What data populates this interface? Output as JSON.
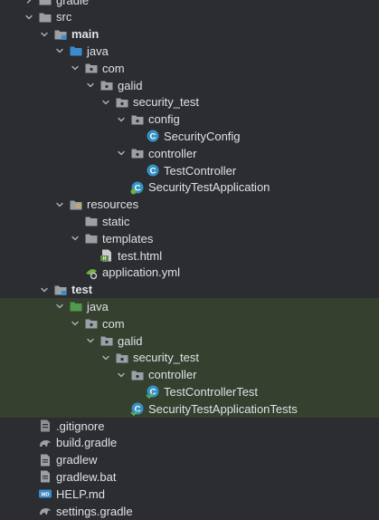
{
  "colors": {
    "background": "#2b2d30",
    "highlight": "#36402f",
    "text": "#dfe1e5",
    "folder": "#9aa0a6",
    "source_folder": "#3c8bcb",
    "test_folder": "#4e9a4e",
    "class_icon": "#3592c4",
    "app_icon": "#3592c4"
  },
  "tree": [
    {
      "label": "gradle",
      "depth": 0,
      "expanded": false,
      "icon": "folder-icon"
    },
    {
      "label": "src",
      "depth": 0,
      "expanded": true,
      "icon": "folder-icon"
    },
    {
      "label": "main",
      "depth": 1,
      "expanded": true,
      "icon": "module-folder-icon",
      "bold": true
    },
    {
      "label": "java",
      "depth": 2,
      "expanded": true,
      "icon": "source-folder-icon"
    },
    {
      "label": "com",
      "depth": 3,
      "expanded": true,
      "icon": "package-icon"
    },
    {
      "label": "galid",
      "depth": 4,
      "expanded": true,
      "icon": "package-icon"
    },
    {
      "label": "security_test",
      "depth": 5,
      "expanded": true,
      "icon": "package-icon"
    },
    {
      "label": "config",
      "depth": 6,
      "expanded": true,
      "icon": "package-icon"
    },
    {
      "label": "SecurityConfig",
      "depth": 7,
      "leaf": true,
      "icon": "class-icon"
    },
    {
      "label": "controller",
      "depth": 6,
      "expanded": true,
      "icon": "package-icon"
    },
    {
      "label": "TestController",
      "depth": 7,
      "leaf": true,
      "icon": "class-icon"
    },
    {
      "label": "SecurityTestApplication",
      "depth": 6,
      "leaf": true,
      "icon": "spring-app-icon"
    },
    {
      "label": "resources",
      "depth": 2,
      "expanded": true,
      "icon": "resources-folder-icon"
    },
    {
      "label": "static",
      "depth": 3,
      "leaf": true,
      "icon": "folder-icon"
    },
    {
      "label": "templates",
      "depth": 3,
      "expanded": true,
      "icon": "folder-icon"
    },
    {
      "label": "test.html",
      "depth": 4,
      "leaf": true,
      "icon": "html-file-icon"
    },
    {
      "label": "application.yml",
      "depth": 3,
      "leaf": true,
      "icon": "yaml-file-icon"
    },
    {
      "label": "test",
      "depth": 1,
      "expanded": true,
      "icon": "module-folder-icon",
      "bold": true
    },
    {
      "label": "java",
      "depth": 2,
      "expanded": true,
      "icon": "test-folder-icon",
      "highlight": true
    },
    {
      "label": "com",
      "depth": 3,
      "expanded": true,
      "icon": "package-icon",
      "highlight": true
    },
    {
      "label": "galid",
      "depth": 4,
      "expanded": true,
      "icon": "package-icon",
      "highlight": true
    },
    {
      "label": "security_test",
      "depth": 5,
      "expanded": true,
      "icon": "package-icon",
      "highlight": true
    },
    {
      "label": "controller",
      "depth": 6,
      "expanded": true,
      "icon": "package-icon",
      "highlight": true
    },
    {
      "label": "TestControllerTest",
      "depth": 7,
      "leaf": true,
      "icon": "test-class-icon",
      "highlight": true
    },
    {
      "label": "SecurityTestApplicationTests",
      "depth": 6,
      "leaf": true,
      "icon": "test-class-icon",
      "highlight": true
    },
    {
      "label": ".gitignore",
      "depth": 0,
      "leaf": true,
      "icon": "gitignore-file-icon"
    },
    {
      "label": "build.gradle",
      "depth": 0,
      "leaf": true,
      "icon": "gradle-file-icon"
    },
    {
      "label": "gradlew",
      "depth": 0,
      "leaf": true,
      "icon": "file-icon"
    },
    {
      "label": "gradlew.bat",
      "depth": 0,
      "leaf": true,
      "icon": "file-icon"
    },
    {
      "label": "HELP.md",
      "depth": 0,
      "leaf": true,
      "icon": "markdown-file-icon"
    },
    {
      "label": "settings.gradle",
      "depth": 0,
      "leaf": true,
      "icon": "gradle-file-icon"
    }
  ]
}
